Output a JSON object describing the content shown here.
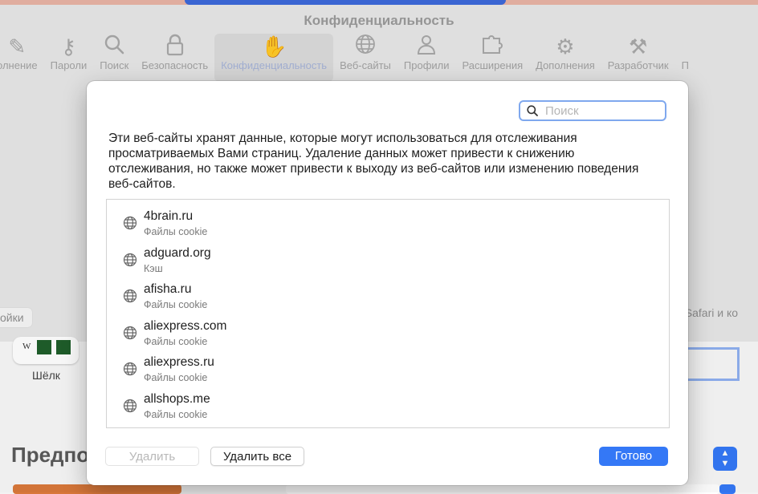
{
  "background": {
    "window_title": "Конфиденциальность",
    "toolbar": [
      {
        "label": "олнение",
        "icon": "pencil-icon"
      },
      {
        "label": "Пароли",
        "icon": "key-icon"
      },
      {
        "label": "Поиск",
        "icon": "search-icon"
      },
      {
        "label": "Безопасность",
        "icon": "lock-icon"
      },
      {
        "label": "Конфиденциальность",
        "icon": "hand-icon",
        "active": true
      },
      {
        "label": "Веб-сайты",
        "icon": "globe-icon"
      },
      {
        "label": "Профили",
        "icon": "person-icon"
      },
      {
        "label": "Расширения",
        "icon": "puzzle-icon"
      },
      {
        "label": "Дополнения",
        "icon": "gears-icon"
      },
      {
        "label": "Разработчик",
        "icon": "tools-icon"
      },
      {
        "label": "П",
        "icon": "more-icon"
      }
    ],
    "left_button_label": "ойки",
    "right_button_label": "О Safari и ко",
    "silk_label": "Шёлк",
    "silk_letter": "W",
    "section_heading_partial": "Предпо"
  },
  "dialog": {
    "search": {
      "placeholder": "Поиск",
      "value": ""
    },
    "description": "Эти веб-сайты хранят данные, которые могут использоваться для отслеживания просматриваемых Вами страниц. Удаление данных может привести к снижению отслеживания, но также может привести к выходу из веб-сайтов или изменению поведения веб-сайтов.",
    "sites": [
      {
        "name": "4brain.ru",
        "data": "Файлы cookie"
      },
      {
        "name": "adguard.org",
        "data": "Кэш"
      },
      {
        "name": "afisha.ru",
        "data": "Файлы cookie"
      },
      {
        "name": "aliexpress.com",
        "data": "Файлы cookie"
      },
      {
        "name": "aliexpress.ru",
        "data": "Файлы cookie"
      },
      {
        "name": "allshops.me",
        "data": "Файлы cookie"
      }
    ],
    "buttons": {
      "delete": "Удалить",
      "delete_all": "Удалить все",
      "done": "Готово"
    }
  },
  "colors": {
    "accent": "#3478f6",
    "focus_ring": "#7fa8ee"
  }
}
